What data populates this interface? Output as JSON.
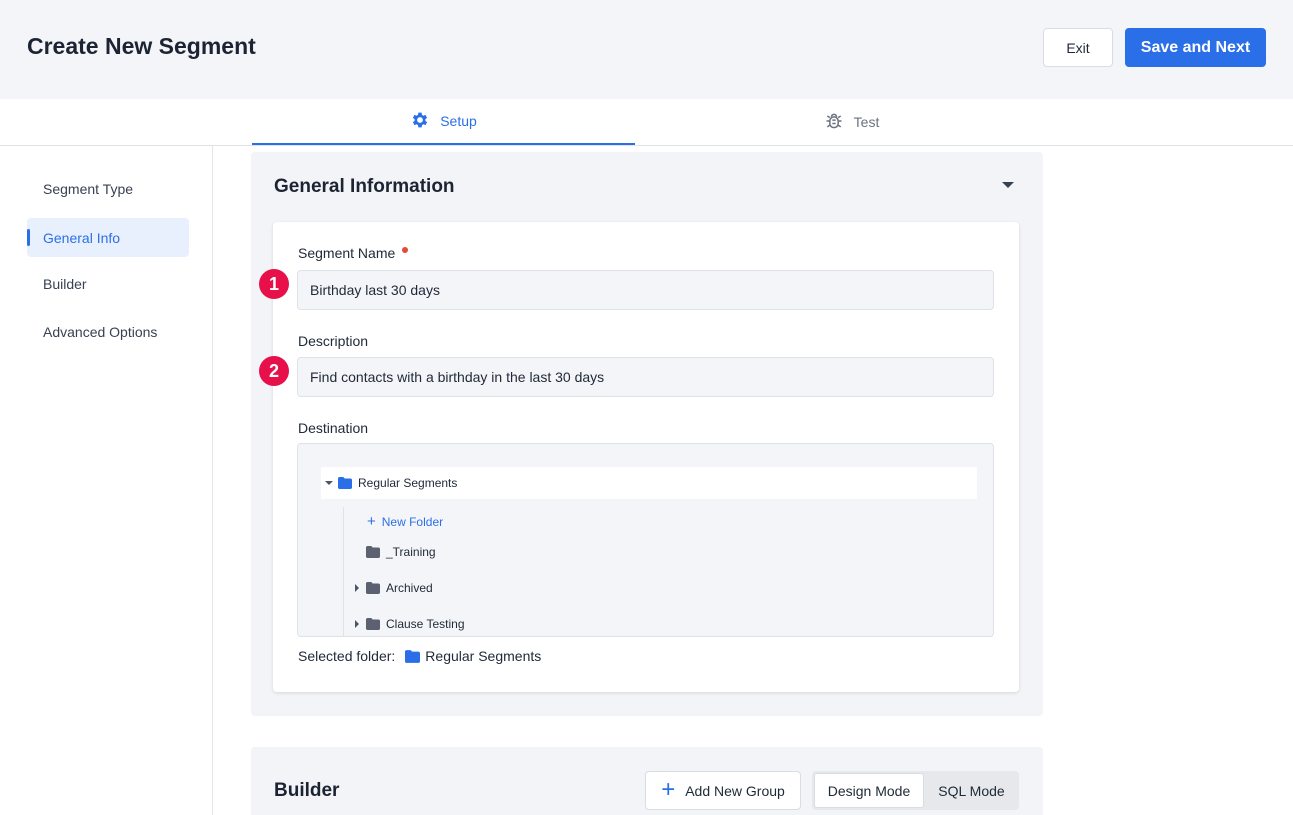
{
  "header": {
    "title": "Create New Segment",
    "exit_label": "Exit",
    "save_label": "Save and Next"
  },
  "tabs": [
    {
      "label": "Setup",
      "icon": "gear-icon",
      "active": true
    },
    {
      "label": "Test",
      "icon": "bug-icon",
      "active": false
    }
  ],
  "sidebar": {
    "items": [
      {
        "label": "Segment Type",
        "active": false
      },
      {
        "label": "General Info",
        "active": true
      },
      {
        "label": "Builder",
        "active": false
      },
      {
        "label": "Advanced Options",
        "active": false
      }
    ]
  },
  "general": {
    "title": "General Information",
    "segment_name_label": "Segment Name",
    "segment_name_value": "Birthday last 30 days",
    "description_label": "Description",
    "description_value": "Find contacts with a birthday in the last 30 days",
    "destination_label": "Destination",
    "badges": [
      "1",
      "2"
    ],
    "tree": {
      "root": "Regular Segments",
      "new_folder": "New Folder",
      "children": [
        "_Training",
        "Archived",
        "Clause Testing"
      ]
    },
    "selected_folder_label": "Selected folder:",
    "selected_folder_value": "Regular Segments"
  },
  "builder": {
    "title": "Builder",
    "add_group_label": "Add New Group",
    "design_mode_label": "Design Mode",
    "sql_mode_label": "SQL Mode"
  },
  "colors": {
    "accent": "#2b6fe8",
    "required": "#e5483d",
    "badge": "#e8104a"
  }
}
